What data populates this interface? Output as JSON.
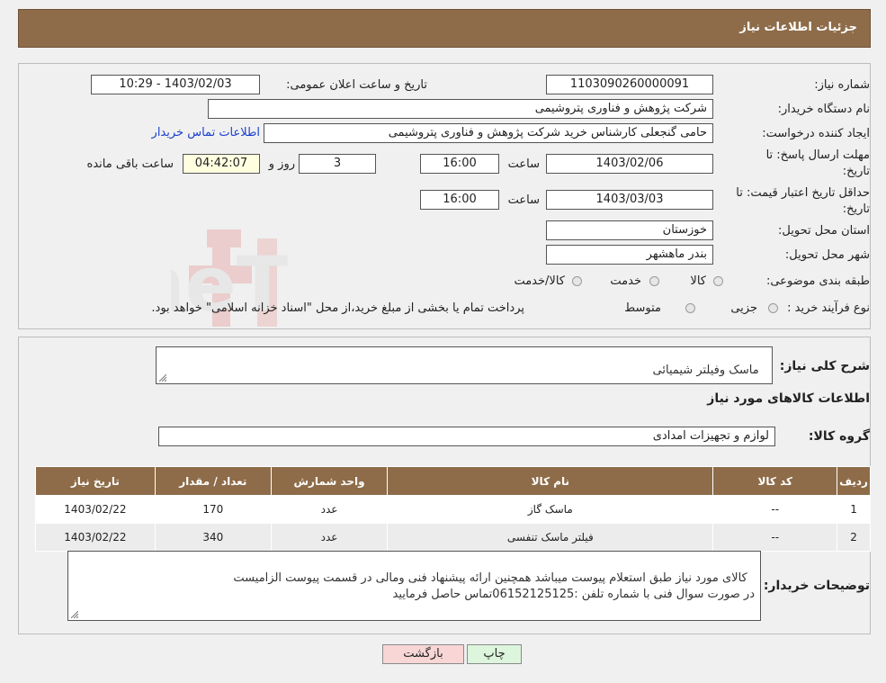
{
  "header": {
    "title": "جزئیات اطلاعات نیاز"
  },
  "form": {
    "need_number_label": "شماره نیاز:",
    "need_number": "1103090260000091",
    "announce_label": "تاریخ و ساعت اعلان عمومی:",
    "announce_value": "1403/02/03 - 10:29",
    "buyer_org_label": "نام دستگاه خریدار:",
    "buyer_org": "شرکت پژوهش و فناوری پتروشیمی",
    "creator_label": "ایجاد کننده درخواست:",
    "creator": "حامی گنجعلی کارشناس خرید شرکت پژوهش و فناوری پتروشیمی",
    "contact_link": "اطلاعات تماس خریدار",
    "deadline_label_1": "مهلت ارسال پاسخ: تا",
    "deadline_label_2": "تاریخ:",
    "deadline_date": "1403/02/06",
    "time_label": "ساعت",
    "deadline_time": "16:00",
    "days_value": "3",
    "days_label": "روز و",
    "remaining_time": "04:42:07",
    "remaining_label": "ساعت باقی مانده",
    "validity_label_1": "حداقل تاریخ اعتبار قیمت: تا",
    "validity_label_2": "تاریخ:",
    "validity_date": "1403/03/03",
    "validity_time_label": "ساعت",
    "validity_time": "16:00",
    "province_label": "استان محل تحویل:",
    "province": "خوزستان",
    "city_label": "شهر محل تحویل:",
    "city": "بندر ماهشهر",
    "category_label": "طبقه بندی موضوعی:",
    "category_options": [
      "کالا",
      "خدمت",
      "کالا/خدمت"
    ],
    "process_label": "نوع فرآیند خرید :",
    "process_options": [
      "جزیی",
      "متوسط"
    ],
    "process_note": "پرداخت تمام یا بخشی از مبلغ خرید،از محل \"اسناد خزانه اسلامی\" خواهد بود."
  },
  "details": {
    "summary_label": "شرح کلی نیاز:",
    "summary": "ماسک وفیلتر شیمیائی",
    "goods_info_title": "اطلاعات کالاهای مورد نیاز",
    "goods_group_label": "گروه کالا:",
    "goods_group": "لوازم و تجهیزات امدادی",
    "table": {
      "headers": [
        "ردیف",
        "کد کالا",
        "نام کالا",
        "واحد شمارش",
        "تعداد / مقدار",
        "تاریخ نیاز"
      ],
      "rows": [
        [
          "1",
          "--",
          "ماسک گاز",
          "عدد",
          "170",
          "1403/02/22"
        ],
        [
          "2",
          "--",
          "فیلتر ماسک تنفسی",
          "عدد",
          "340",
          "1403/02/22"
        ]
      ]
    },
    "buyer_notes_label": "توضیحات خریدار:",
    "buyer_notes": "کالای مورد نیاز طبق استعلام پیوست میباشد همچنین ارائه پیشنهاد فنی ومالی در قسمت پیوست الزامیست\nدر صورت سوال فنی با شماره تلفن :06152125125تماس حاصل فرمایید"
  },
  "buttons": {
    "print": "چاپ",
    "back": "بازگشت"
  },
  "watermark": {
    "text": "AriaTender.neT"
  },
  "colors": {
    "header_bg": "#8e6c49",
    "link": "#1a3fd0",
    "back_btn": "#f8d6d6",
    "print_btn": "#dcf5dc",
    "watermark": "#d9534f"
  }
}
